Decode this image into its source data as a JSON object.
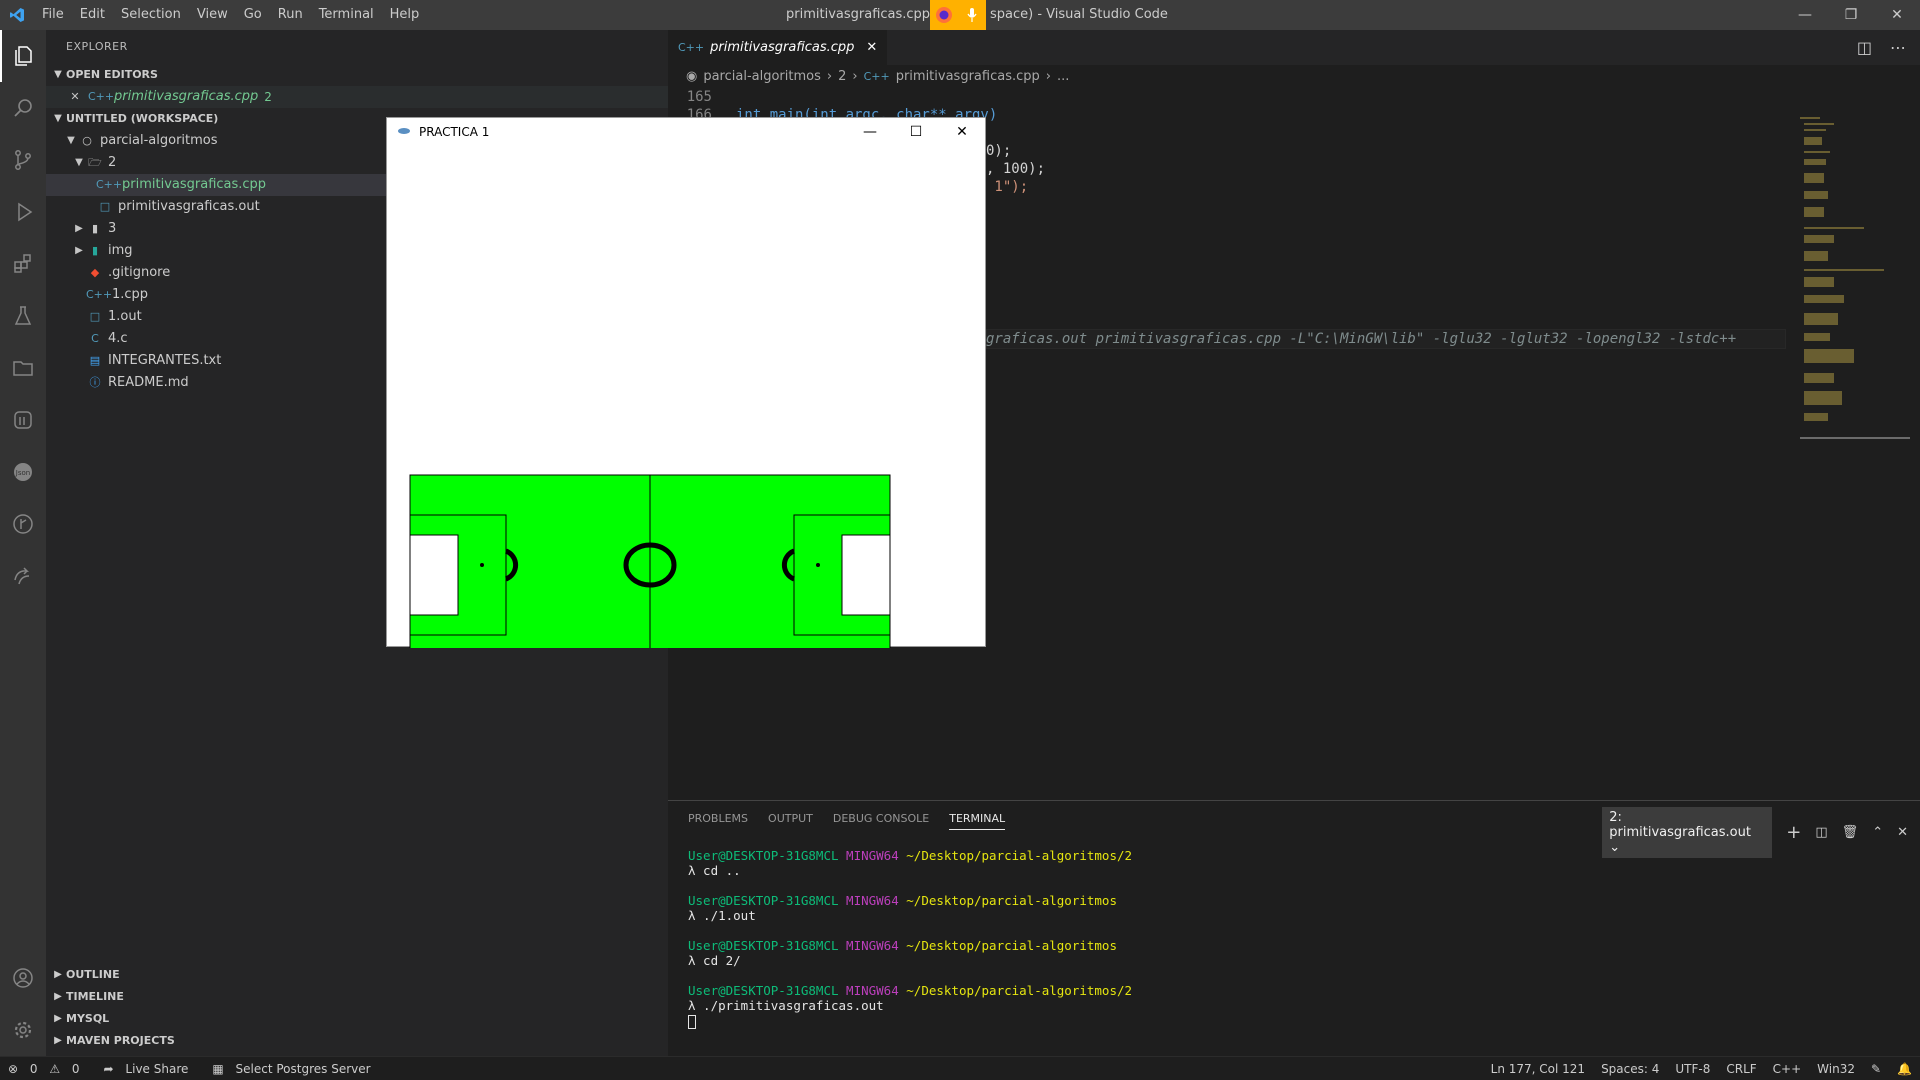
{
  "window": {
    "title": "primitivasgraficas.cpp - Untitled (Workspace) - Visual Studio Code",
    "title_visible_left": "primitivasgraficas.cpp - Unt",
    "title_visible_right": "space) - Visual Studio Code"
  },
  "menu": [
    "File",
    "Edit",
    "Selection",
    "View",
    "Go",
    "Run",
    "Terminal",
    "Help"
  ],
  "sidebar": {
    "header": "EXPLORER",
    "open_editors": "OPEN EDITORS",
    "open_file": "primitivasgraficas.cpp",
    "open_file_badge": "2",
    "workspace": "UNTITLED (WORKSPACE)",
    "tree": [
      {
        "label": "parcial-algoritmos",
        "indent": 1
      },
      {
        "label": "2",
        "indent": 2
      },
      {
        "label": "primitivasgraficas.cpp",
        "indent": 3
      },
      {
        "label": "primitivasgraficas.out",
        "indent": 3
      },
      {
        "label": "3",
        "indent": 2
      },
      {
        "label": "img",
        "indent": 2
      },
      {
        "label": ".gitignore",
        "indent": 2
      },
      {
        "label": "1.cpp",
        "indent": 2
      },
      {
        "label": "1.out",
        "indent": 2
      },
      {
        "label": "4.c",
        "indent": 2
      },
      {
        "label": "INTEGRANTES.txt",
        "indent": 2
      },
      {
        "label": "README.md",
        "indent": 2
      }
    ],
    "bottom_sections": [
      "OUTLINE",
      "TIMELINE",
      "MYSQL",
      "MAVEN PROJECTS"
    ]
  },
  "editor": {
    "tab": "primitivasgraficas.cpp",
    "breadcrumb": [
      "parcial-algoritmos",
      "2",
      "primitivasgraficas.cpp",
      "..."
    ],
    "line165": "165",
    "line166": "166",
    "code166": "int main(int argc, char** argv)",
    "frag1": "0);",
    "frag2": ", 100);",
    "frag3": " 1\");",
    "cmd": "graficas.out primitivasgraficas.cpp -L\"C:\\MinGW\\lib\" -lglu32 -lglut32 -lopengl32 -lstdc++"
  },
  "panel": {
    "tabs": [
      "PROBLEMS",
      "OUTPUT",
      "DEBUG CONSOLE",
      "TERMINAL"
    ],
    "terminal_select": "2: primitivasgraficas.out",
    "lines": [
      {
        "user": "User@DESKTOP-31G8MCL",
        "sys": "MINGW64",
        "path": "~/Desktop/parcial-algoritmos/2",
        "cmd": " λ cd .."
      },
      {
        "user": "User@DESKTOP-31G8MCL",
        "sys": "MINGW64",
        "path": "~/Desktop/parcial-algoritmos",
        "cmd": " λ ./1.out"
      },
      {
        "user": "User@DESKTOP-31G8MCL",
        "sys": "MINGW64",
        "path": "~/Desktop/parcial-algoritmos",
        "cmd": " λ cd 2/"
      },
      {
        "user": "User@DESKTOP-31G8MCL",
        "sys": "MINGW64",
        "path": "~/Desktop/parcial-algoritmos/2",
        "cmd": " λ ./primitivasgraficas.out"
      }
    ]
  },
  "glut": {
    "title": "PRACTICA 1",
    "field_color": "#00ff00"
  },
  "status": {
    "errors": "0",
    "warnings": "0",
    "liveshare": "Live Share",
    "postgres": "Select Postgres Server",
    "position": "Ln 177, Col 121",
    "spaces": "Spaces: 4",
    "encoding": "UTF-8",
    "eol": "CRLF",
    "lang": "C++",
    "platform": "Win32"
  },
  "colors": {
    "accent": "#007acc",
    "titlebar": "#3c3c3c",
    "sidebar": "#252526",
    "editor": "#1e1e1e"
  }
}
